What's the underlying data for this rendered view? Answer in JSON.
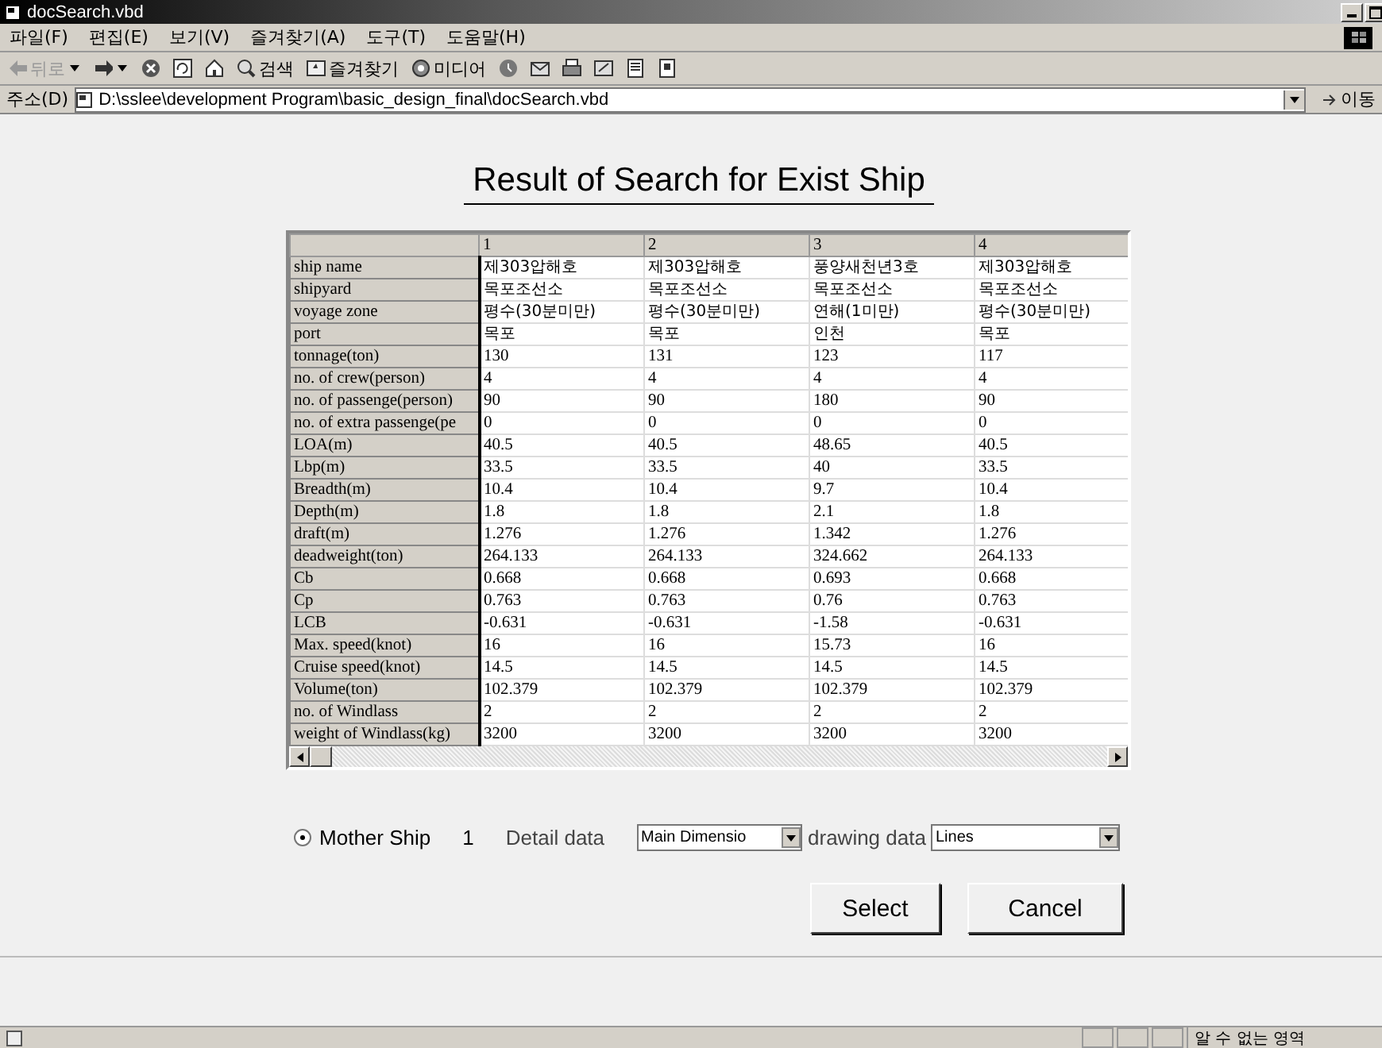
{
  "window": {
    "title": "docSearch.vbd"
  },
  "menu": [
    "파일(F)",
    "편집(E)",
    "보기(V)",
    "즐겨찾기(A)",
    "도구(T)",
    "도움말(H)"
  ],
  "toolbar": [
    {
      "kind": "back",
      "label": "뒤로",
      "disabled": true
    },
    {
      "kind": "forward",
      "disabled": false
    },
    {
      "kind": "stop"
    },
    {
      "kind": "refresh"
    },
    {
      "kind": "home"
    },
    {
      "kind": "search",
      "label": "검색"
    },
    {
      "kind": "favorites",
      "label": "즐겨찾기"
    },
    {
      "kind": "media",
      "label": "미디어"
    },
    {
      "kind": "history"
    },
    {
      "kind": "mail"
    },
    {
      "kind": "print"
    },
    {
      "kind": "edit"
    },
    {
      "kind": "discuss"
    },
    {
      "kind": "messenger"
    }
  ],
  "address_bar": {
    "label": "주소(D)",
    "value": "D:\\sslee\\development Program\\basic_design_final\\docSearch.vbd",
    "go": "이동"
  },
  "page": {
    "heading": "Result of Search for Exist Ship",
    "table": {
      "columns": [
        "1",
        "2",
        "3",
        "4"
      ],
      "rows": [
        {
          "label": "ship name",
          "values": [
            "제303압해호",
            "제303압해호",
            "풍양새천년3호",
            "제303압해호"
          ]
        },
        {
          "label": "shipyard",
          "values": [
            "목포조선소",
            "목포조선소",
            "목포조선소",
            "목포조선소"
          ]
        },
        {
          "label": "voyage zone",
          "values": [
            "평수(30분미만)",
            "평수(30분미만)",
            "연해(1미만)",
            "평수(30분미만)"
          ]
        },
        {
          "label": "port",
          "values": [
            "목포",
            "목포",
            "인천",
            "목포"
          ]
        },
        {
          "label": "tonnage(ton)",
          "values": [
            "130",
            "131",
            "123",
            "117"
          ]
        },
        {
          "label": "no. of crew(person)",
          "values": [
            "4",
            "4",
            "4",
            "4"
          ]
        },
        {
          "label": "no. of passenge(person)",
          "values": [
            "90",
            "90",
            "180",
            "90"
          ]
        },
        {
          "label": "no. of extra passenge(pe",
          "values": [
            "0",
            "0",
            "0",
            "0"
          ]
        },
        {
          "label": "LOA(m)",
          "values": [
            "40.5",
            "40.5",
            "48.65",
            "40.5"
          ]
        },
        {
          "label": "Lbp(m)",
          "values": [
            "33.5",
            "33.5",
            "40",
            "33.5"
          ]
        },
        {
          "label": "Breadth(m)",
          "values": [
            "10.4",
            "10.4",
            "9.7",
            "10.4"
          ]
        },
        {
          "label": "Depth(m)",
          "values": [
            "1.8",
            "1.8",
            "2.1",
            "1.8"
          ]
        },
        {
          "label": "draft(m)",
          "values": [
            "1.276",
            "1.276",
            "1.342",
            "1.276"
          ]
        },
        {
          "label": "deadweight(ton)",
          "values": [
            "264.133",
            "264.133",
            "324.662",
            "264.133"
          ]
        },
        {
          "label": "Cb",
          "values": [
            "0.668",
            "0.668",
            "0.693",
            "0.668"
          ]
        },
        {
          "label": "Cp",
          "values": [
            "0.763",
            "0.763",
            "0.76",
            "0.763"
          ]
        },
        {
          "label": "LCB",
          "values": [
            "-0.631",
            "-0.631",
            "-1.58",
            "-0.631"
          ]
        },
        {
          "label": "Max. speed(knot)",
          "values": [
            "16",
            "16",
            "15.73",
            "16"
          ]
        },
        {
          "label": "Cruise speed(knot)",
          "values": [
            "14.5",
            "14.5",
            "14.5",
            "14.5"
          ]
        },
        {
          "label": "Volume(ton)",
          "values": [
            "102.379",
            "102.379",
            "102.379",
            "102.379"
          ]
        },
        {
          "label": "no. of Windlass",
          "values": [
            "2",
            "2",
            "2",
            "2"
          ]
        },
        {
          "label": "weight of Windlass(kg)",
          "values": [
            "3200",
            "3200",
            "3200",
            "3200"
          ]
        }
      ]
    },
    "radio": {
      "label": "Mother Ship",
      "selected": true
    },
    "count": "1",
    "detail_label": "Detail data",
    "detail_select": "Main Dimensio",
    "drawing_label": "drawing data",
    "drawing_select": "Lines",
    "buttons": [
      "Select",
      "Cancel"
    ]
  },
  "status_bar": {
    "zone": "알 수 없는 영역"
  }
}
